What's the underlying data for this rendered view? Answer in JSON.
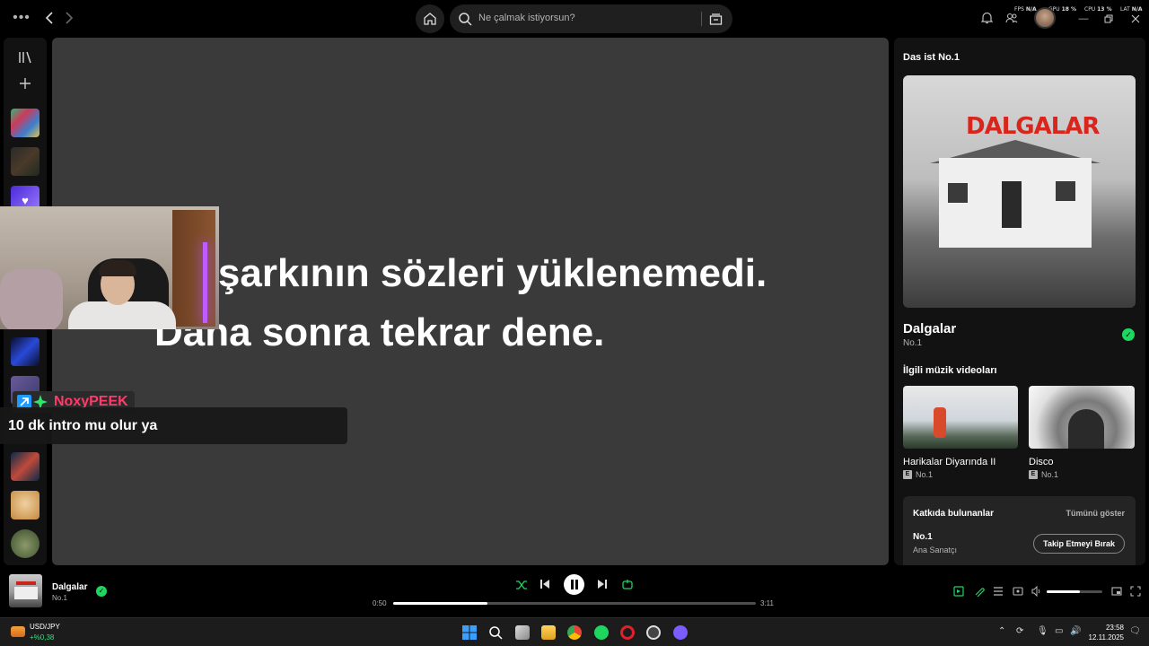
{
  "topbar": {
    "search_placeholder": "Ne çalmak istiyorsun?",
    "stats": [
      {
        "label": "FPS",
        "value": "N/A"
      },
      {
        "label": "GPU",
        "value": "18 %"
      },
      {
        "label": "CPU",
        "value": "13 %"
      },
      {
        "label": "LAT",
        "value": "N/A"
      }
    ]
  },
  "main": {
    "lyrics_message": "Bu şarkının sözleri yüklenemedi. Daha sonra tekrar dene."
  },
  "chat": {
    "username": "NoxyPEEK",
    "message": "10 dk intro mu olur ya"
  },
  "right_panel": {
    "header": "Das ist No.1",
    "cover_text": "DALGALAR",
    "song_title": "Dalgalar",
    "artist": "No.1",
    "videos_heading": "İlgili müzik videoları",
    "videos": [
      {
        "title": "Harikalar Diyarında II",
        "artist": "No.1",
        "explicit": "E"
      },
      {
        "title": "Disco",
        "artist": "No.1",
        "explicit": "E"
      }
    ],
    "credits": {
      "title": "Katkıda bulunanlar",
      "show_all": "Tümünü göster",
      "name": "No.1",
      "role": "Ana Sanatçı",
      "button": "Takip Etmeyi Bırak"
    }
  },
  "player": {
    "title": "Dalgalar",
    "artist": "No.1",
    "elapsed": "0:50",
    "duration": "3:11",
    "progress_fraction": 0.26,
    "volume_fraction": 0.6
  },
  "taskbar": {
    "ticker_name": "USD/JPY",
    "ticker_value": "+%0,38",
    "time": "23:58",
    "date": "12.11.2025"
  },
  "colors": {
    "accent_green": "#1ed760",
    "chat_name": "#ff3b6b",
    "main_bg": "#3a3a3a"
  }
}
